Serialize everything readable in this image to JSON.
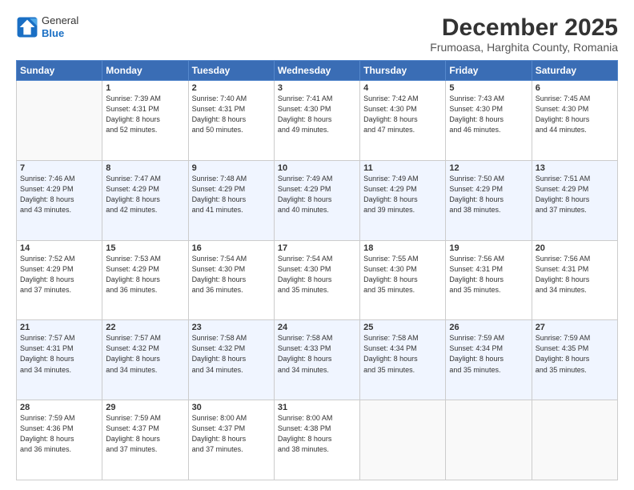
{
  "logo": {
    "general": "General",
    "blue": "Blue"
  },
  "header": {
    "title": "December 2025",
    "subtitle": "Frumoasa, Harghita County, Romania"
  },
  "weekdays": [
    "Sunday",
    "Monday",
    "Tuesday",
    "Wednesday",
    "Thursday",
    "Friday",
    "Saturday"
  ],
  "weeks": [
    [
      {
        "day": "",
        "info": ""
      },
      {
        "day": "1",
        "info": "Sunrise: 7:39 AM\nSunset: 4:31 PM\nDaylight: 8 hours\nand 52 minutes."
      },
      {
        "day": "2",
        "info": "Sunrise: 7:40 AM\nSunset: 4:31 PM\nDaylight: 8 hours\nand 50 minutes."
      },
      {
        "day": "3",
        "info": "Sunrise: 7:41 AM\nSunset: 4:30 PM\nDaylight: 8 hours\nand 49 minutes."
      },
      {
        "day": "4",
        "info": "Sunrise: 7:42 AM\nSunset: 4:30 PM\nDaylight: 8 hours\nand 47 minutes."
      },
      {
        "day": "5",
        "info": "Sunrise: 7:43 AM\nSunset: 4:30 PM\nDaylight: 8 hours\nand 46 minutes."
      },
      {
        "day": "6",
        "info": "Sunrise: 7:45 AM\nSunset: 4:30 PM\nDaylight: 8 hours\nand 44 minutes."
      }
    ],
    [
      {
        "day": "7",
        "info": "Sunrise: 7:46 AM\nSunset: 4:29 PM\nDaylight: 8 hours\nand 43 minutes."
      },
      {
        "day": "8",
        "info": "Sunrise: 7:47 AM\nSunset: 4:29 PM\nDaylight: 8 hours\nand 42 minutes."
      },
      {
        "day": "9",
        "info": "Sunrise: 7:48 AM\nSunset: 4:29 PM\nDaylight: 8 hours\nand 41 minutes."
      },
      {
        "day": "10",
        "info": "Sunrise: 7:49 AM\nSunset: 4:29 PM\nDaylight: 8 hours\nand 40 minutes."
      },
      {
        "day": "11",
        "info": "Sunrise: 7:49 AM\nSunset: 4:29 PM\nDaylight: 8 hours\nand 39 minutes."
      },
      {
        "day": "12",
        "info": "Sunrise: 7:50 AM\nSunset: 4:29 PM\nDaylight: 8 hours\nand 38 minutes."
      },
      {
        "day": "13",
        "info": "Sunrise: 7:51 AM\nSunset: 4:29 PM\nDaylight: 8 hours\nand 37 minutes."
      }
    ],
    [
      {
        "day": "14",
        "info": "Sunrise: 7:52 AM\nSunset: 4:29 PM\nDaylight: 8 hours\nand 37 minutes."
      },
      {
        "day": "15",
        "info": "Sunrise: 7:53 AM\nSunset: 4:29 PM\nDaylight: 8 hours\nand 36 minutes."
      },
      {
        "day": "16",
        "info": "Sunrise: 7:54 AM\nSunset: 4:30 PM\nDaylight: 8 hours\nand 36 minutes."
      },
      {
        "day": "17",
        "info": "Sunrise: 7:54 AM\nSunset: 4:30 PM\nDaylight: 8 hours\nand 35 minutes."
      },
      {
        "day": "18",
        "info": "Sunrise: 7:55 AM\nSunset: 4:30 PM\nDaylight: 8 hours\nand 35 minutes."
      },
      {
        "day": "19",
        "info": "Sunrise: 7:56 AM\nSunset: 4:31 PM\nDaylight: 8 hours\nand 35 minutes."
      },
      {
        "day": "20",
        "info": "Sunrise: 7:56 AM\nSunset: 4:31 PM\nDaylight: 8 hours\nand 34 minutes."
      }
    ],
    [
      {
        "day": "21",
        "info": "Sunrise: 7:57 AM\nSunset: 4:31 PM\nDaylight: 8 hours\nand 34 minutes."
      },
      {
        "day": "22",
        "info": "Sunrise: 7:57 AM\nSunset: 4:32 PM\nDaylight: 8 hours\nand 34 minutes."
      },
      {
        "day": "23",
        "info": "Sunrise: 7:58 AM\nSunset: 4:32 PM\nDaylight: 8 hours\nand 34 minutes."
      },
      {
        "day": "24",
        "info": "Sunrise: 7:58 AM\nSunset: 4:33 PM\nDaylight: 8 hours\nand 34 minutes."
      },
      {
        "day": "25",
        "info": "Sunrise: 7:58 AM\nSunset: 4:34 PM\nDaylight: 8 hours\nand 35 minutes."
      },
      {
        "day": "26",
        "info": "Sunrise: 7:59 AM\nSunset: 4:34 PM\nDaylight: 8 hours\nand 35 minutes."
      },
      {
        "day": "27",
        "info": "Sunrise: 7:59 AM\nSunset: 4:35 PM\nDaylight: 8 hours\nand 35 minutes."
      }
    ],
    [
      {
        "day": "28",
        "info": "Sunrise: 7:59 AM\nSunset: 4:36 PM\nDaylight: 8 hours\nand 36 minutes."
      },
      {
        "day": "29",
        "info": "Sunrise: 7:59 AM\nSunset: 4:37 PM\nDaylight: 8 hours\nand 37 minutes."
      },
      {
        "day": "30",
        "info": "Sunrise: 8:00 AM\nSunset: 4:37 PM\nDaylight: 8 hours\nand 37 minutes."
      },
      {
        "day": "31",
        "info": "Sunrise: 8:00 AM\nSunset: 4:38 PM\nDaylight: 8 hours\nand 38 minutes."
      },
      {
        "day": "",
        "info": ""
      },
      {
        "day": "",
        "info": ""
      },
      {
        "day": "",
        "info": ""
      }
    ]
  ]
}
